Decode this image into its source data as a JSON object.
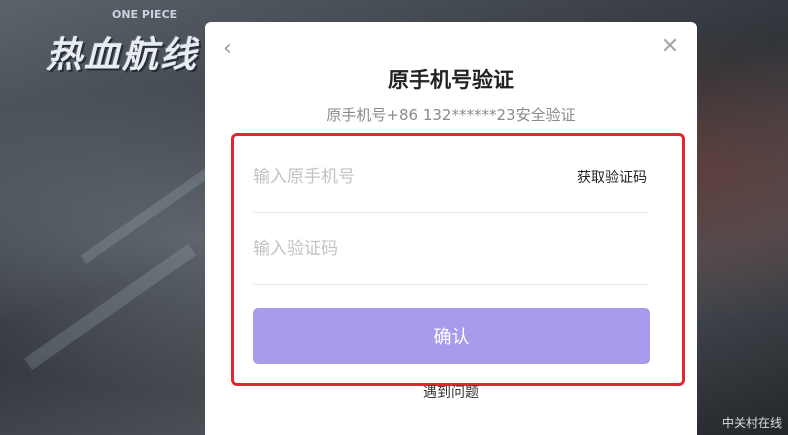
{
  "background": {
    "game_logo": "热血航线",
    "game_logo_sub": "ONE PIECE",
    "watermark": "中关村在线"
  },
  "dialog": {
    "title": "原手机号验证",
    "subtitle": "原手机号+86 132******23安全验证",
    "phone_input": {
      "placeholder": "输入原手机号",
      "value": ""
    },
    "get_code_label": "获取验证码",
    "code_input": {
      "placeholder": "输入验证码",
      "value": ""
    },
    "confirm_label": "确认",
    "help_label": "遇到问题",
    "back_icon": "chevron-left-icon",
    "close_icon": "close-icon"
  },
  "colors": {
    "confirm_bg": "#a89bec",
    "highlight_border": "#e0282e"
  }
}
